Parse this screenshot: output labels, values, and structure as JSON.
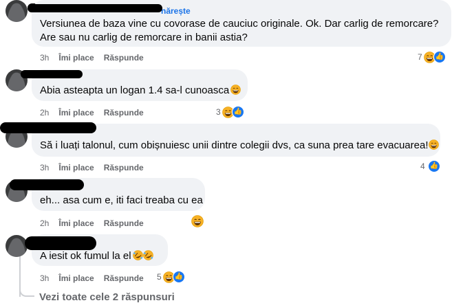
{
  "comments": [
    {
      "name_visible": "nărește",
      "text": "Versiunea de baza vine cu covorase de cauciuc originale. Ok. Dar carlig de remorcare?\nAre sau nu carlig de remorcare in banii astia?",
      "time": "3h",
      "like_label": "Îmi place",
      "reply_label": "Răspunde",
      "reaction_count": "7"
    },
    {
      "name_visible": "",
      "text": "Abia asteapta un logan 1.4 sa-l cunoasca",
      "time": "2h",
      "like_label": "Îmi place",
      "reply_label": "Răspunde",
      "reaction_count": "3"
    },
    {
      "name_visible": "",
      "text": "Să i luați talonul, cum obișnuiesc unii dintre colegii dvs, ca suna prea tare evacuarea!",
      "time": "3h",
      "like_label": "Îmi place",
      "reply_label": "Răspunde",
      "reaction_count": "4"
    },
    {
      "name_visible": "",
      "text": "eh... asa cum e, iti faci treaba cu ea",
      "time": "2h",
      "like_label": "Îmi place",
      "reply_label": "Răspunde",
      "reaction_count": ""
    },
    {
      "name_visible": "",
      "text": "A iesit ok fumul la el",
      "time": "3h",
      "like_label": "Îmi place",
      "reply_label": "Răspunde",
      "reaction_count": "5"
    }
  ],
  "view_replies": "Vezi toate cele 2 răspunsuri",
  "colors": {
    "bubble": "#f0f2f5",
    "meta": "#65676b",
    "link": "#1a73e8",
    "like_blue": "#1877f2",
    "haha_yellow": "#f7b125"
  },
  "icons": [
    "haha-reaction-icon",
    "like-reaction-icon",
    "laughing-emoji-icon",
    "rofl-emoji-icon"
  ]
}
